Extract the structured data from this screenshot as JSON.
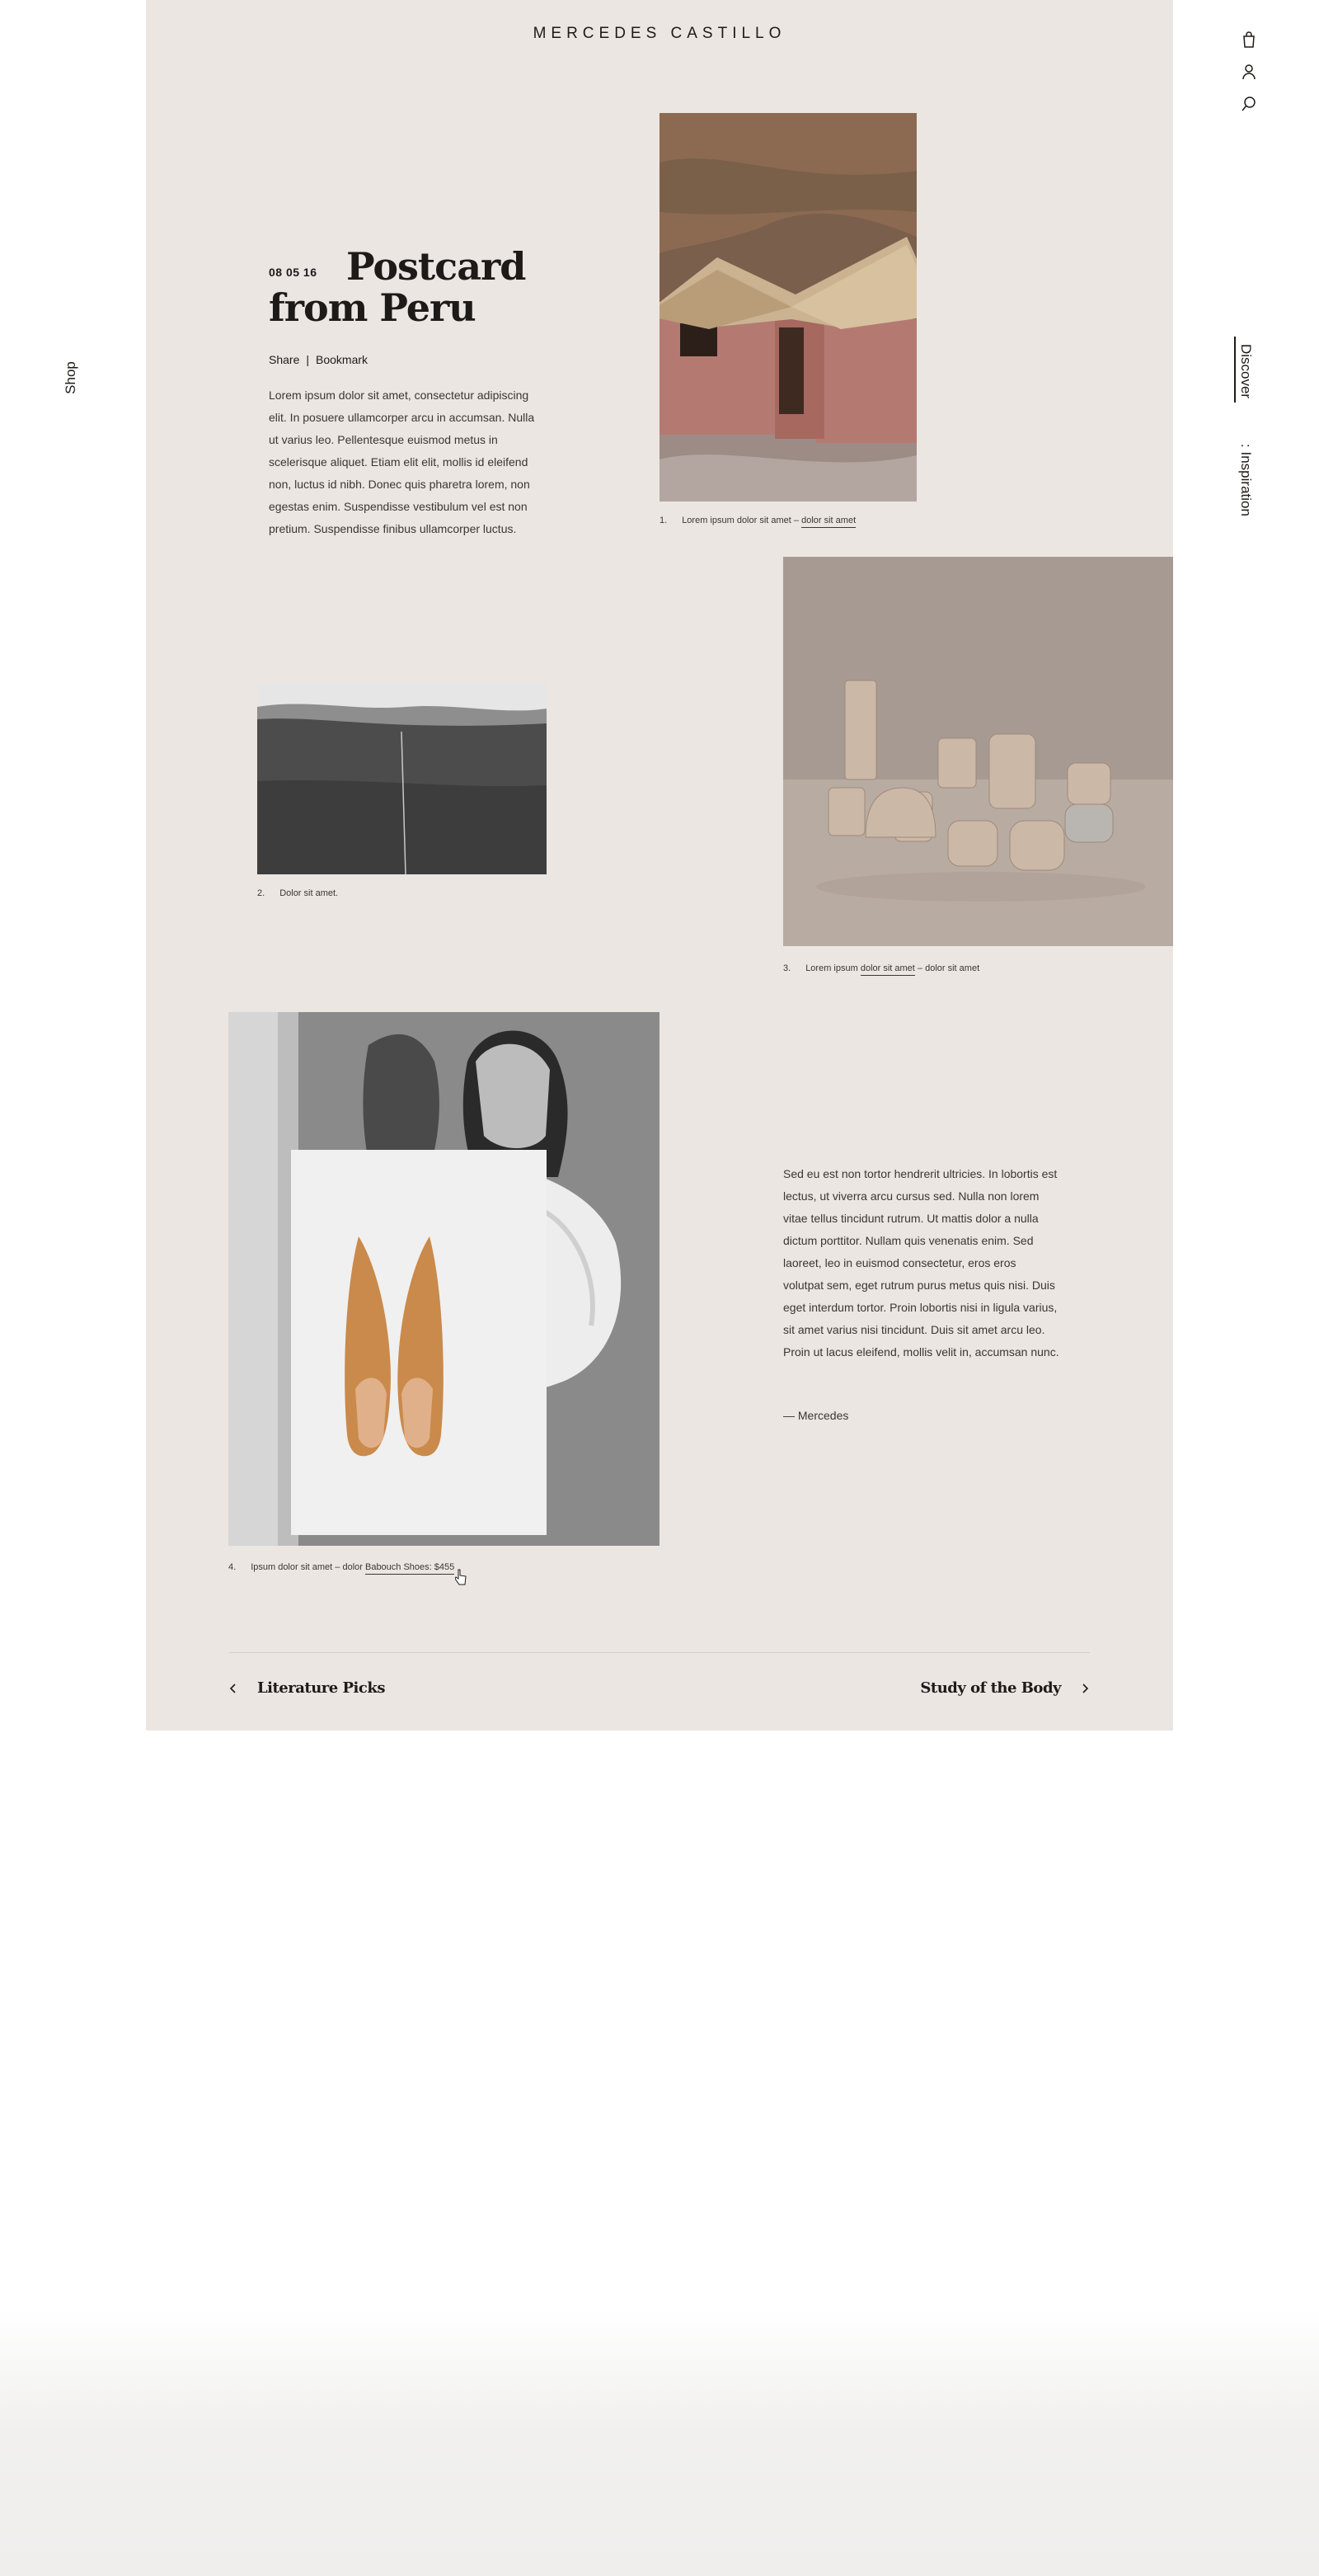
{
  "brand": "MERCEDES CASTILLO",
  "side_nav": {
    "left": "Shop",
    "right_active": "Discover",
    "right_secondary": ": Inspiration"
  },
  "header_icons": [
    "bag-icon",
    "user-icon",
    "search-icon"
  ],
  "article": {
    "date": "08 05 16",
    "title_line1": "Postcard",
    "title_line2": "from Peru",
    "share": "Share",
    "separator": "|",
    "bookmark": "Bookmark",
    "intro": "Lorem ipsum dolor sit amet, consectetur adipiscing elit. In posuere ullamcorper arcu in accumsan. Nulla ut varius leo. Pellentesque euismod metus in scelerisque aliquet. Etiam elit elit, mollis id eleifend non, luctus id nibh. Donec quis pharetra lorem, non egestas enim. Suspendisse vestibulum vel est non pretium. Suspendisse finibus ullamcorper luctus.",
    "body2": "Sed eu est non tortor hendrerit ultricies. In lobortis est lectus, ut viverra arcu cursus sed. Nulla non lorem vitae tellus tincidunt rutrum. Ut mattis dolor a nulla dictum porttitor. Nullam quis venenatis enim. Sed laoreet, leo in euismod consectetur, eros eros volutpat sem, eget rutrum purus metus quis nisi. Duis eget interdum tortor. Proin lobortis nisi in ligula varius, sit amet varius nisi tincidunt. Duis sit amet arcu leo. Proin ut lacus eleifend, mollis velit in, accumsan nunc.",
    "signoff": "— Mercedes"
  },
  "captions": {
    "c1": {
      "num": "1.",
      "text": "Lorem ipsum dolor sit amet –",
      "link": "dolor sit amet"
    },
    "c2": {
      "num": "2.",
      "text": "Dolor sit amet."
    },
    "c3": {
      "num": "3.",
      "pre": "Lorem ipsum",
      "link": "dolor sit amet",
      "post": "– dolor sit amet"
    },
    "c4": {
      "num": "4.",
      "text": "Ipsum dolor sit amet – dolor",
      "link": "Babouch Shoes: $455"
    }
  },
  "images": [
    "hut-photo",
    "desert-photo",
    "pottery-photo",
    "model-photo",
    "slippers-photo"
  ],
  "pagination": {
    "prev": "Literature Picks",
    "next": "Study of the Body"
  },
  "colors": {
    "panel": "#ebe6e2",
    "text": "#1d1a18",
    "hut_wall": "#b47a72",
    "pottery_bg": "#a69a92",
    "slipper": "#c98a4b"
  }
}
